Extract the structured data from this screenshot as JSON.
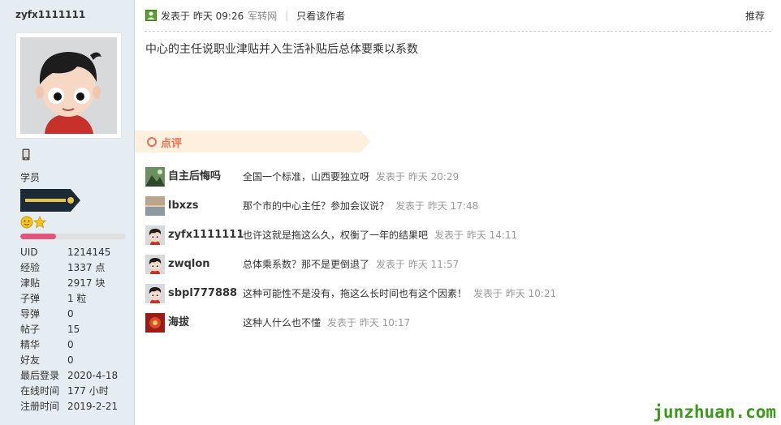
{
  "profile": {
    "username": "zyfx1111111",
    "rank": "学员",
    "level_progress": 0.34,
    "stats": [
      {
        "key": "UID",
        "value": "1214145"
      },
      {
        "key": "经验",
        "value": "1337 点"
      },
      {
        "key": "津贴",
        "value": "2917 块"
      },
      {
        "key": "子弹",
        "value": "1 粒"
      },
      {
        "key": "导弹",
        "value": "0"
      },
      {
        "key": "帖子",
        "value": "15"
      },
      {
        "key": "精华",
        "value": "0"
      },
      {
        "key": "好友",
        "value": "0"
      },
      {
        "key": "最后登录",
        "value": "2020-4-18"
      },
      {
        "key": "在线时间",
        "value": "177 小时"
      },
      {
        "key": "注册时间",
        "value": "2019-2-21"
      }
    ]
  },
  "post": {
    "posted_at": "发表于 昨天 09:26",
    "source": "军转网",
    "author_only": "只看该作者",
    "recommend": "推荐",
    "body": "中心的主任说职业津贴并入生活补贴后总体要乘以系数"
  },
  "comments": {
    "title": "点评",
    "items": [
      {
        "user": "自主后悔吗",
        "text": "全国一个标准，山西要独立呀",
        "time": "发表于 昨天 20:29",
        "avatar": "landscape-icon"
      },
      {
        "user": "lbxzs",
        "text": "那个市的中心主任？参加会议说？",
        "time": "发表于 昨天 17:48",
        "avatar": "sunset-icon"
      },
      {
        "user": "zyfx1111111",
        "text": "也许这就是拖这么久，权衡了一年的结果吧",
        "time": "发表于 昨天 14:11",
        "avatar": "cartoon-face-icon"
      },
      {
        "user": "zwqlon",
        "text": "总体乘系数？那不是更倒退了",
        "time": "发表于 昨天 11:57",
        "avatar": "cartoon-face-icon"
      },
      {
        "user": "sbpl777888",
        "text": "这种可能性不是没有，拖这么长时间也有这个因素！",
        "time": "发表于 昨天 10:21",
        "avatar": "cartoon-face-icon"
      },
      {
        "user": "海拔",
        "text": "这种人什么也不懂",
        "time": "发表于 昨天 10:17",
        "avatar": "red-photo-icon"
      }
    ]
  },
  "watermark": "junzhuan.com",
  "colors": {
    "sidebar_bg": "#e5edf2",
    "accent": "#f26c4f",
    "level_fill": "#e0567d",
    "watermark": "#3c9a1a"
  }
}
